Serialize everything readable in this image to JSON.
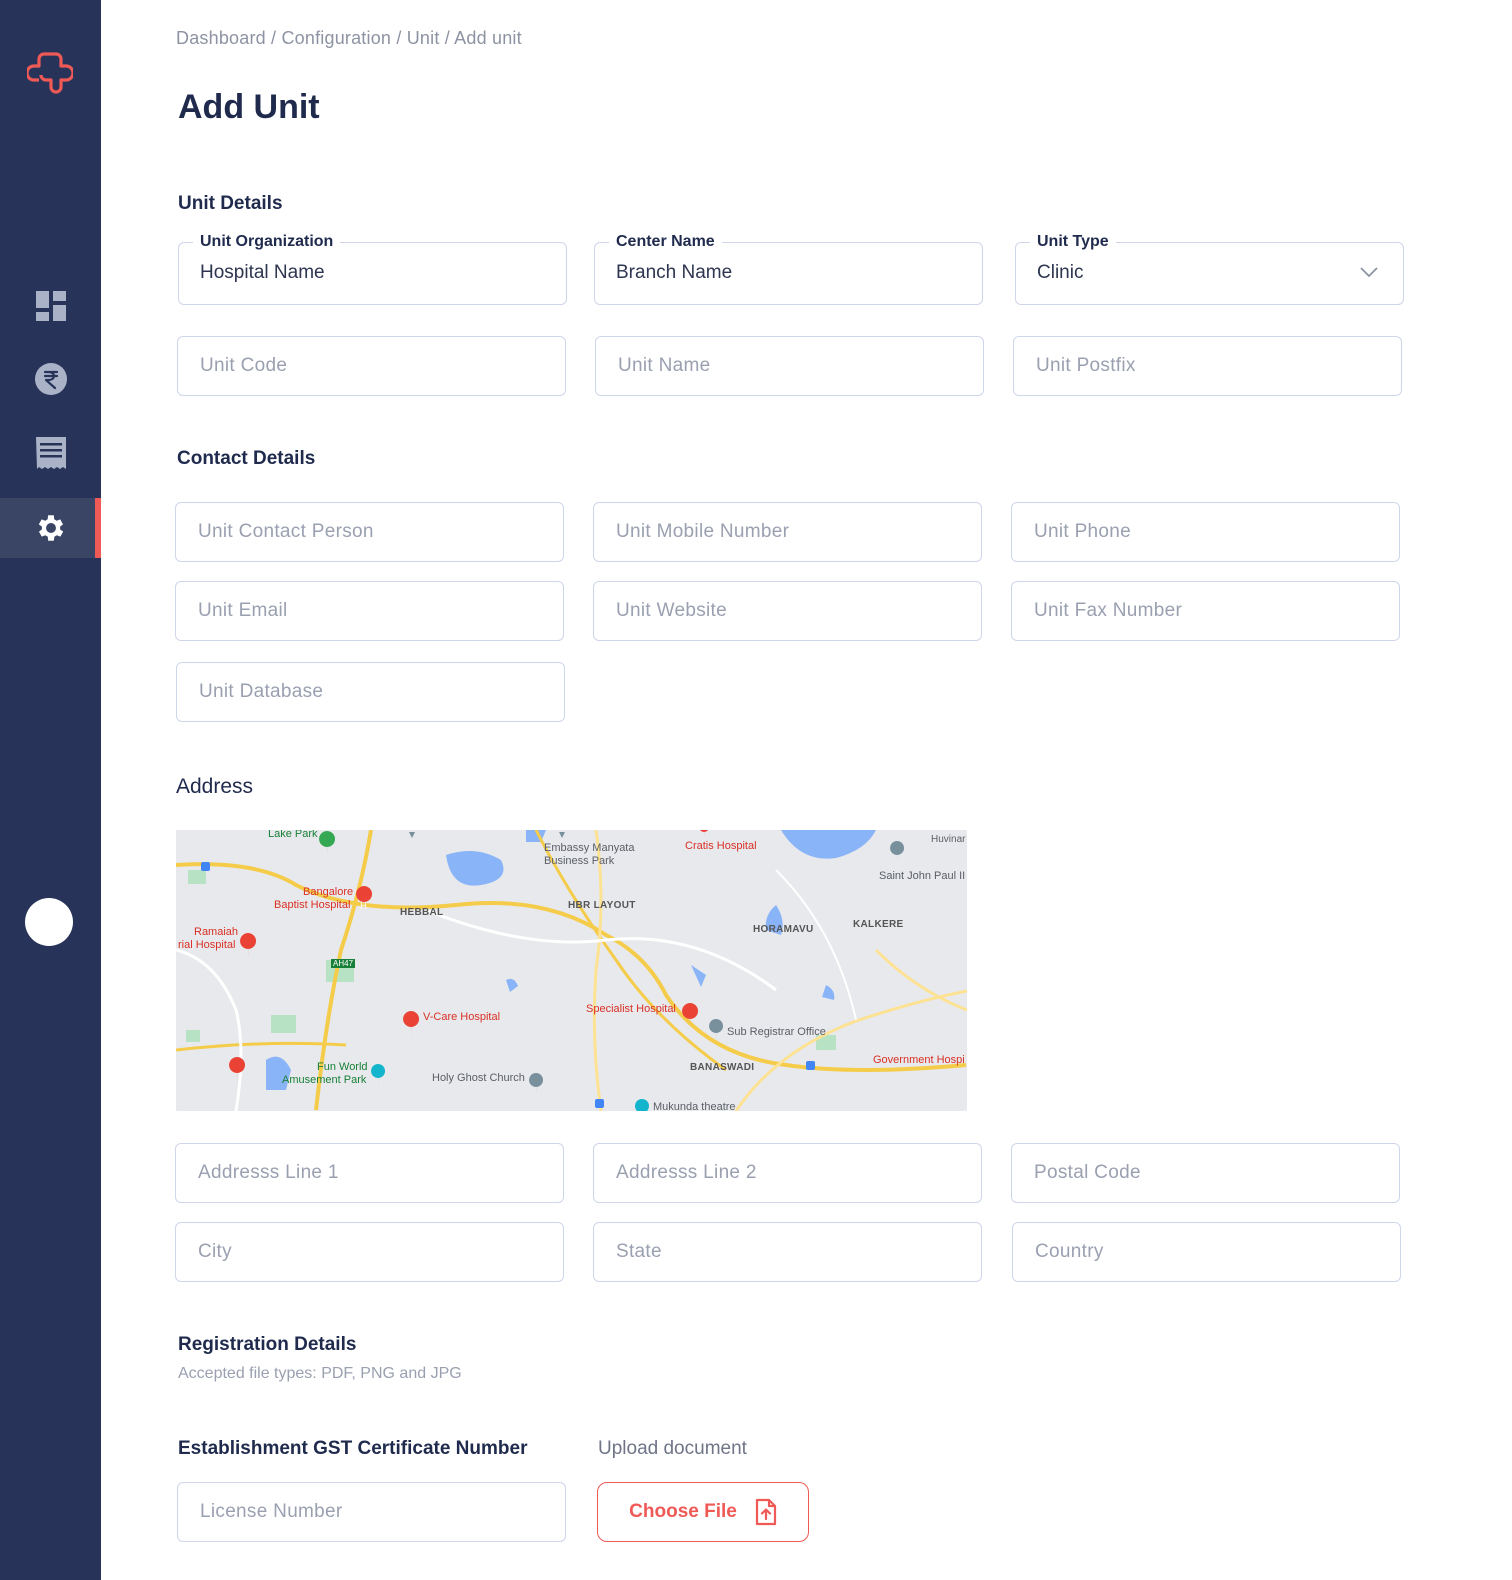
{
  "breadcrumb": "Dashboard / Configuration / Unit / Add unit",
  "page_title": "Add Unit",
  "sections": {
    "unit_details": "Unit Details",
    "contact_details": "Contact Details",
    "address": "Address",
    "registration": "Registration Details",
    "registration_note": "Accepted file types: PDF, PNG and JPG",
    "gst": "Establishment GST Certificate Number"
  },
  "unit_fields": {
    "organization": {
      "label": "Unit Organization",
      "value": "Hospital Name"
    },
    "center": {
      "label": "Center Name",
      "value": "Branch Name"
    },
    "type": {
      "label": "Unit Type",
      "value": "Clinic"
    },
    "code_placeholder": "Unit Code",
    "name_placeholder": "Unit Name",
    "postfix_placeholder": "Unit Postfix"
  },
  "contact_fields": {
    "person": "Unit Contact Person",
    "mobile": "Unit Mobile Number",
    "phone": "Unit Phone",
    "email": "Unit Email",
    "website": "Unit Website",
    "fax": "Unit Fax Number",
    "database": "Unit Database"
  },
  "address_fields": {
    "line1": "Addresss Line 1",
    "line2": "Addresss Line 2",
    "postal": "Postal Code",
    "city": "City",
    "state": "State",
    "country": "Country"
  },
  "map_labels": {
    "lake_park": "Lake Park",
    "embassy": "Embassy Manyata",
    "business_park": "Business Park",
    "cratis": "Cratis Hospital",
    "huvinar": "Huvinar",
    "saint_john": "Saint John Paul II",
    "bangalore": "Bangalore",
    "baptist": "Baptist Hospital",
    "hebbal": "HEBBAL",
    "hbr": "HBR LAYOUT",
    "horamavu": "HORAMAVU",
    "kalkere": "KALKERE",
    "ramaiah": "Ramaiah",
    "rial_hospital": "rial Hospital",
    "vcare": "V-Care Hospital",
    "specialist": "Specialist Hospital",
    "sub_registrar": "Sub Registrar Office",
    "banaswadi": "BANASWADI",
    "government": "Government Hospi",
    "fun_world": "Fun World",
    "amusement": "Amusement Park",
    "holy_ghost": "Holy Ghost Church",
    "mukunda": "Mukunda theatre",
    "ah47": "AH47"
  },
  "registration": {
    "license_placeholder": "License Number",
    "upload_label": "Upload document",
    "choose_file": "Choose File"
  },
  "colors": {
    "sidebar": "#273359",
    "accent": "#ef5a57",
    "title": "#1f2a4d",
    "border": "#cfd6ea"
  },
  "nav_icons": [
    "dashboard-icon",
    "rupee-icon",
    "receipt-icon",
    "gear-icon"
  ]
}
